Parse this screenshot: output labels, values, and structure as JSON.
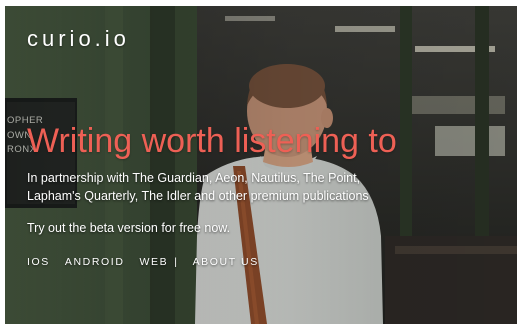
{
  "brand": {
    "logo": "curio.io"
  },
  "hero": {
    "headline": "Writing worth listening to",
    "partners_line1": "In partnership with The Guardian, Aeon, Nautilus, The Point,",
    "partners_line2": "Lapham's Quarterly, The Idler and other premium publications",
    "beta_text": "Try out the beta version for free now."
  },
  "sign": {
    "line1": "OPHER",
    "line2": "OWN",
    "line3": "RONX"
  },
  "nav": {
    "ios": "IOS",
    "android": "ANDROID",
    "web": "WEB",
    "separator": "|",
    "about": "ABOUT US"
  },
  "colors": {
    "headline": "#ee6055",
    "text": "#ffffff"
  }
}
